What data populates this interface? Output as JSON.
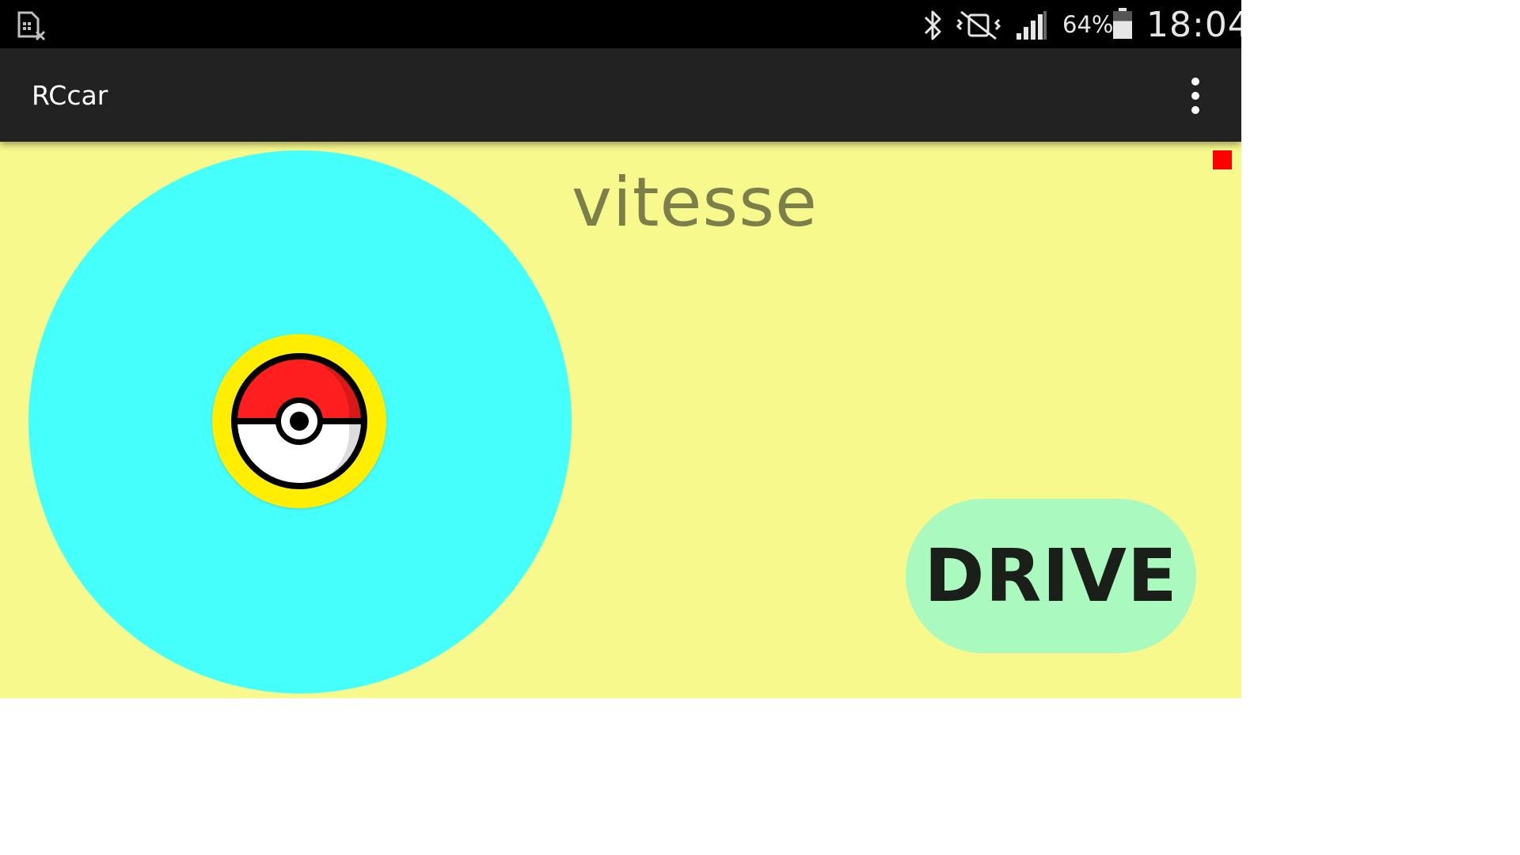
{
  "status_bar": {
    "notification_icon": "sim-card-missing-icon",
    "bluetooth_icon": "bluetooth-icon",
    "vibrate_mute_icon": "vibrate-muted-icon",
    "signal_icon": "cellular-signal-icon",
    "battery_percent": "64%",
    "battery_icon": "battery-icon",
    "battery_level": 0.64,
    "time": "18:04"
  },
  "action_bar": {
    "title": "RCcar",
    "overflow_icon": "more-vert-icon"
  },
  "main": {
    "speed_label": "vitesse",
    "drive_button_label": "DRIVE",
    "joystick_knob_icon": "pokeball-icon",
    "indicator_color": "#ff0000"
  },
  "colors": {
    "background": "#f7f98d",
    "joystick_pad": "#44fffb",
    "joystick_knob": "#ffee00",
    "drive_button": "#aaf9be",
    "action_bar": "#212121",
    "status_bar": "#000000"
  }
}
